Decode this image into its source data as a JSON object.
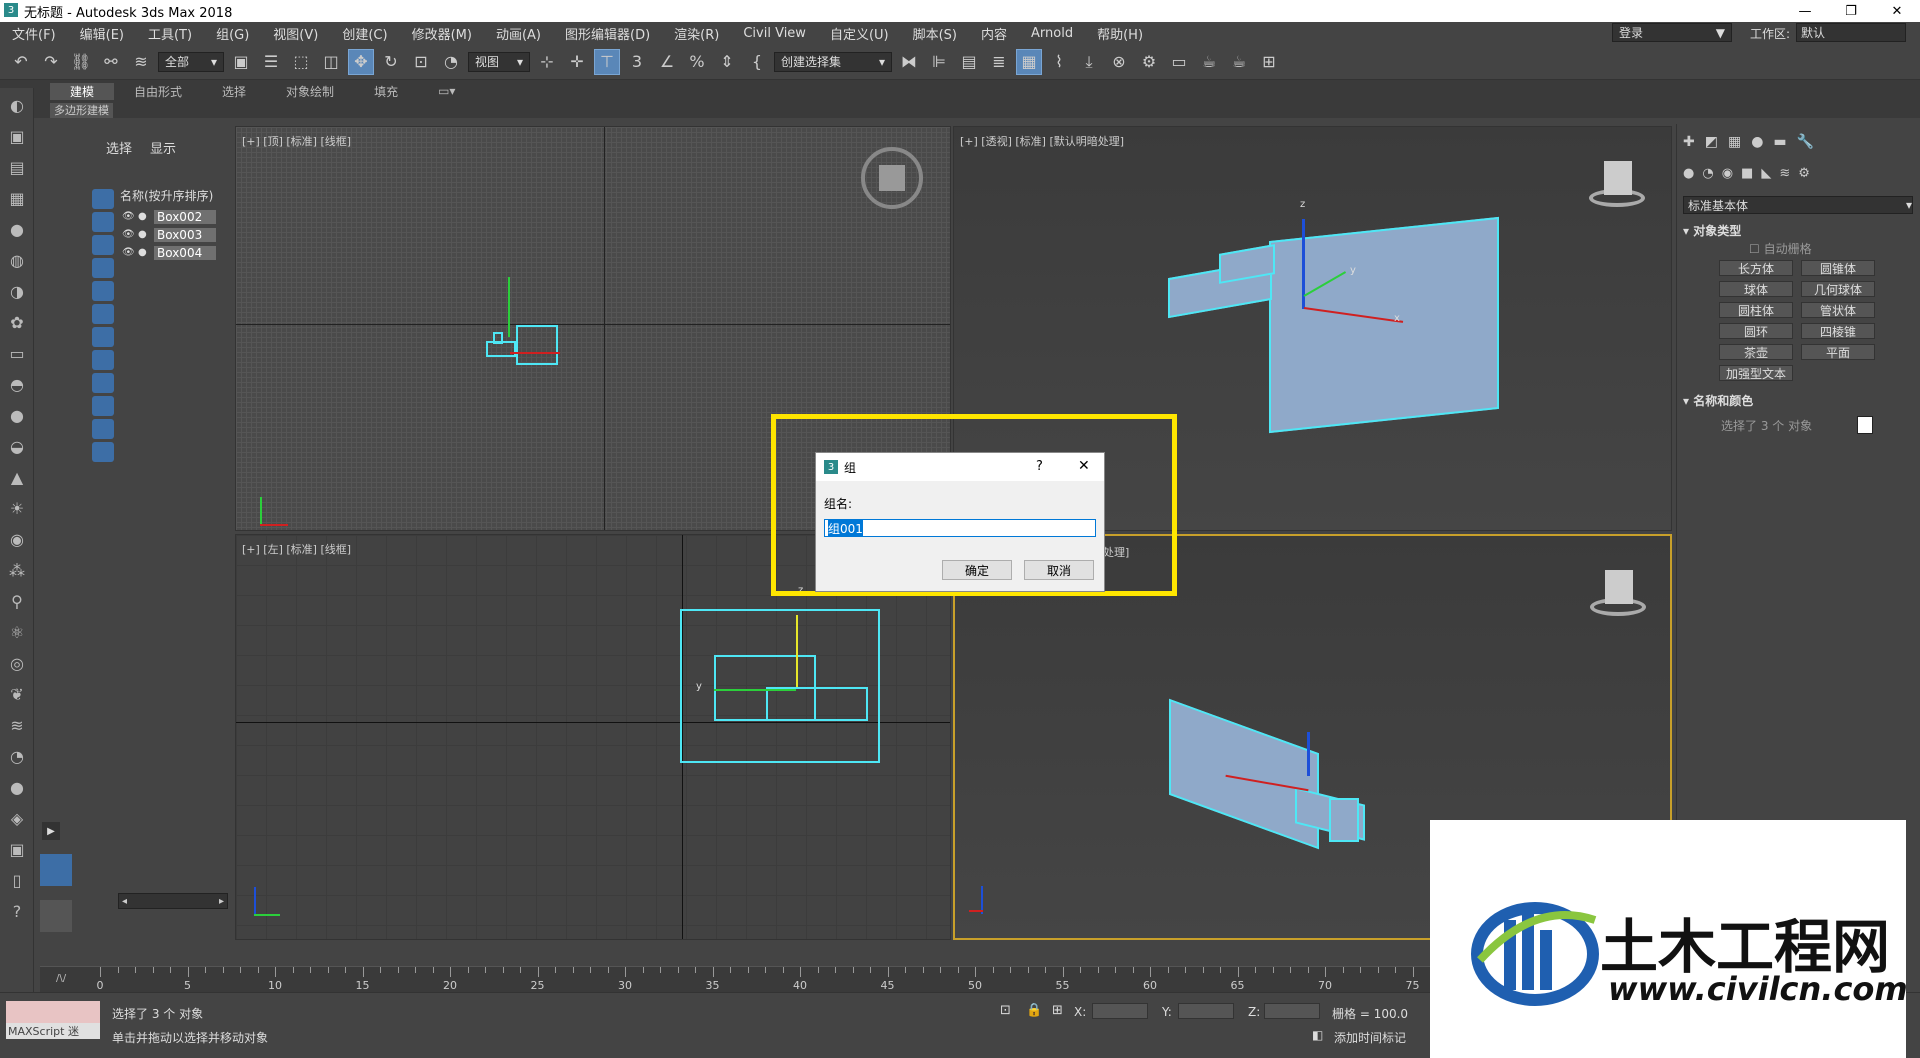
{
  "window": {
    "title": "无标题 - Autodesk 3ds Max 2018",
    "minimize": "—",
    "restore": "❐",
    "close": "✕"
  },
  "menu": [
    "文件(F)",
    "编辑(E)",
    "工具(T)",
    "组(G)",
    "视图(V)",
    "创建(C)",
    "修改器(M)",
    "动画(A)",
    "图形编辑器(D)",
    "渲染(R)",
    "Civil View",
    "自定义(U)",
    "脚本(S)",
    "内容",
    "Arnold",
    "帮助(H)"
  ],
  "account": {
    "login": "登录",
    "workspace_label": "工作区:",
    "workspace_value": "默认"
  },
  "toolbar": {
    "filter": "全部",
    "refcoord": "视图",
    "selset": "创建选择集"
  },
  "ribbon": {
    "tabs": [
      "建模",
      "自由形式",
      "选择",
      "对象绘制",
      "填充"
    ],
    "sub": "多边形建模"
  },
  "scene_explorer": {
    "tabs": [
      "选择",
      "显示"
    ],
    "header": "名称(按升序排序)",
    "items": [
      "Box002",
      "Box003",
      "Box004"
    ]
  },
  "viewports": {
    "top": "[+] [顶] [标准] [线框]",
    "persp": "[+] [透视] [标准] [默认明暗处理]",
    "left": "[+] [左] [标准] [线框]",
    "front": "处理]"
  },
  "axis_labels": {
    "x": "x",
    "y": "y",
    "z": "z"
  },
  "command_panel": {
    "category": "标准基本体",
    "object_type_header": "对象类型",
    "autogrid": "自动栅格",
    "buttons": [
      "长方体",
      "圆锥体",
      "球体",
      "几何球体",
      "圆柱体",
      "管状体",
      "圆环",
      "四棱锥",
      "茶壶",
      "平面",
      "加强型文本"
    ],
    "name_color_header": "名称和颜色",
    "name_value": "选择了 3 个 对象"
  },
  "timeline": {
    "ticks": [
      "0",
      "5",
      "10",
      "15",
      "20",
      "25",
      "30",
      "35",
      "40",
      "45",
      "50",
      "55",
      "60",
      "65",
      "70",
      "75"
    ]
  },
  "status": {
    "selected": "选择了 3 个 对象",
    "hint": "单击并拖动以选择并移动对象",
    "maxscript": "MAXScript 迷",
    "x": "X:",
    "y": "Y:",
    "z": "Z:",
    "grid": "栅格 = 100.0",
    "addtime": "添加时间标记"
  },
  "dialog": {
    "title": "组",
    "help": "?",
    "close": "✕",
    "label": "组名:",
    "value": "组001",
    "ok": "确定",
    "cancel": "取消"
  },
  "watermark": {
    "brand": "土木工程网",
    "url": "www.civilcn.com"
  },
  "colors": {
    "highlight": "#ffe600",
    "selection": "#4ee7f5",
    "accent": "#5a87b8"
  }
}
